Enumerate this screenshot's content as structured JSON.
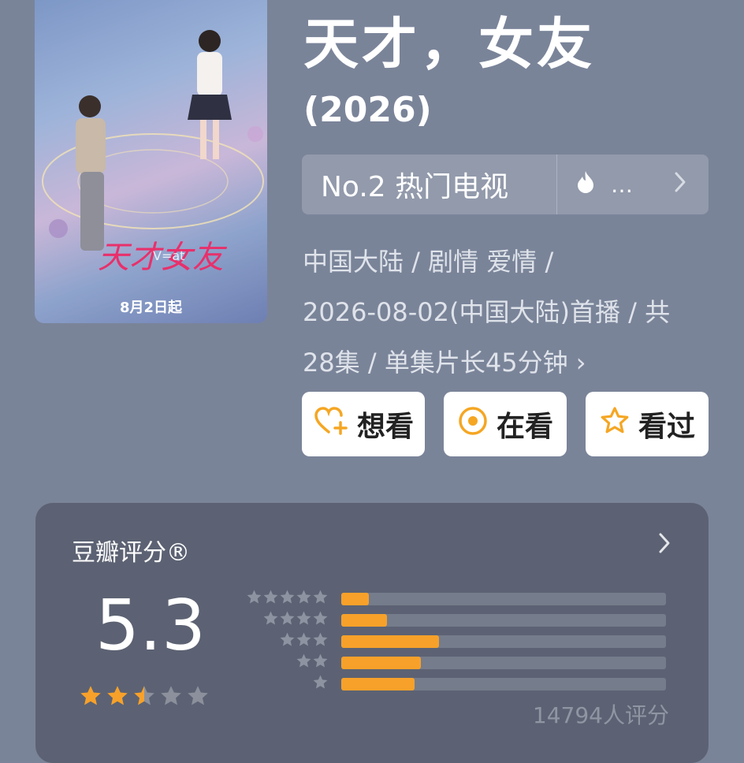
{
  "poster": {
    "date_text": "8月2日起"
  },
  "title": "天才，女友",
  "year": "(2026)",
  "rank": {
    "label": "No.2 热门电视",
    "more": "…",
    "chevron": "chevron-right-icon"
  },
  "meta": {
    "line1": "中国大陆 / 剧情 爱情 /",
    "line2": "2026-08-02(中国大陆)首播 / 共",
    "line3": "28集 / 单集片长45分钟",
    "chevron": "›"
  },
  "actions": [
    {
      "label": "想看",
      "icon": "heart-plus-icon"
    },
    {
      "label": "在看",
      "icon": "target-icon"
    },
    {
      "label": "看过",
      "icon": "star-outline-icon"
    }
  ],
  "rating": {
    "title": "豆瓣评分®",
    "chevron": "›",
    "score": "5.3",
    "stars_value": 2.5,
    "stars_max": 5,
    "distribution": [
      {
        "stars": 5,
        "percent": 8.5
      },
      {
        "stars": 4,
        "percent": 14
      },
      {
        "stars": 3,
        "percent": 30
      },
      {
        "stars": 2,
        "percent": 24.5
      },
      {
        "stars": 1,
        "percent": 22.5
      }
    ],
    "count_text": "14794人评分"
  },
  "colors": {
    "accent": "#f7a12a",
    "background": "#7a8499",
    "card": "#5c6273"
  }
}
